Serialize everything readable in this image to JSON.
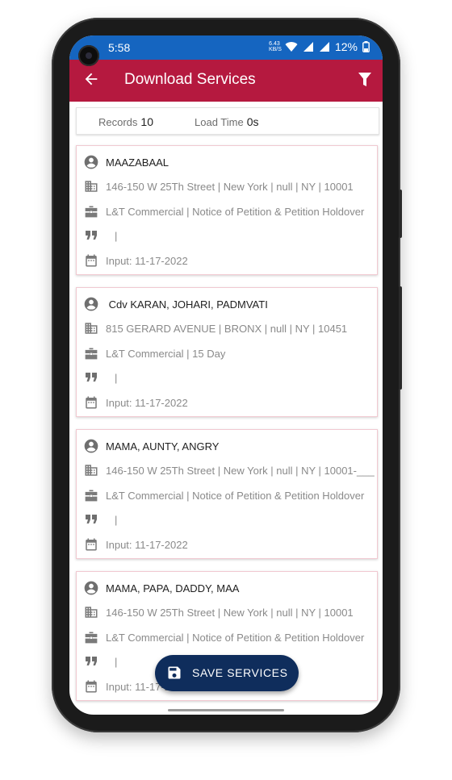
{
  "status_bar": {
    "time": "5:58",
    "net_speed_value": "6.43",
    "net_speed_unit": "KB/S",
    "battery": "12%"
  },
  "app_bar": {
    "title": "Download Services"
  },
  "summary": {
    "records_label": "Records",
    "records_value": "10",
    "load_time_label": "Load Time",
    "load_time_value": "0s"
  },
  "records": [
    {
      "name": "MAAZABAAL",
      "address": "146-150 W 25Th Street | New York | null | NY | 10001",
      "case_type": "L&T Commercial | Notice of Petition & Petition Holdover",
      "note": "|",
      "input": "Input: 11-17-2022"
    },
    {
      "name": " Cdv KARAN, JOHARI, PADMVATI",
      "address": "815 GERARD AVENUE | BRONX | null | NY | 10451",
      "case_type": "L&T Commercial | 15 Day",
      "note": "|",
      "input": "Input: 11-17-2022"
    },
    {
      "name": "MAMA, AUNTY, ANGRY",
      "address": "146-150 W 25Th Street | New York | null | NY | 10001-___",
      "case_type": "L&T Commercial | Notice of Petition & Petition Holdover",
      "note": "|",
      "input": "Input: 11-17-2022"
    },
    {
      "name": "MAMA, PAPA, DADDY, MAA",
      "address": "146-150 W 25Th Street | New York | null | NY | 10001",
      "case_type": "L&T Commercial | Notice of Petition & Petition Holdover",
      "note": "|",
      "input": "Input: 11-17-2022"
    }
  ],
  "fab": {
    "label": "SAVE SERVICES"
  },
  "colors": {
    "app_bar": "#b5193f",
    "status_bar": "#1565c0",
    "fab": "#0f2d5c"
  }
}
